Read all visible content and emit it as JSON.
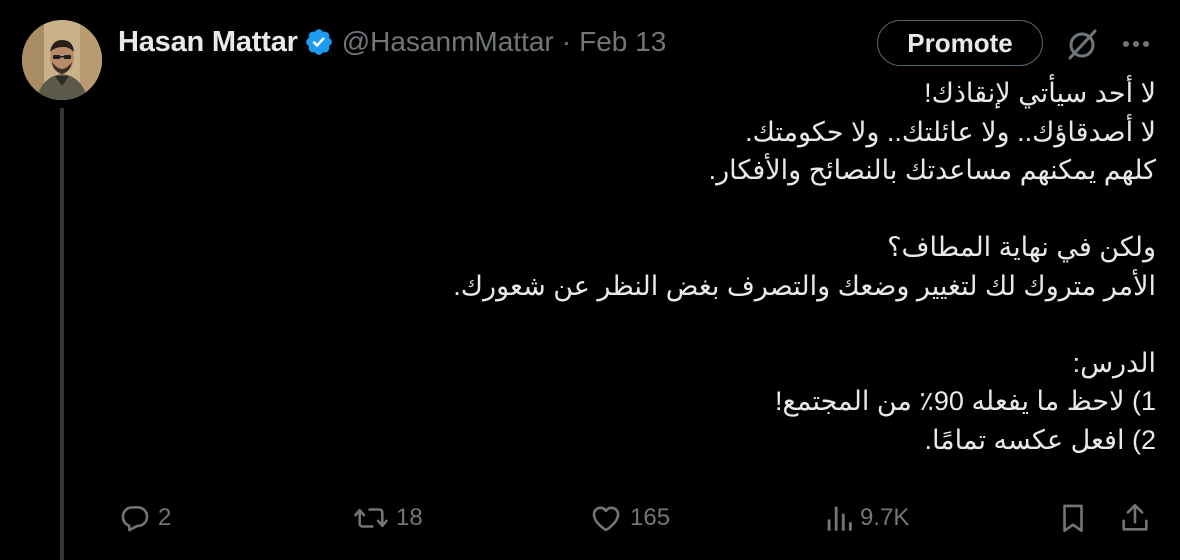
{
  "author": {
    "name": "Hasan Mattar",
    "handle": "@HasanmMattar",
    "separator": "·",
    "date": "Feb 13",
    "verified": true
  },
  "header_actions": {
    "promote_label": "Promote",
    "grok_icon": "slashed-circle-icon",
    "more_icon": "more-dots-icon"
  },
  "tweet_lines": [
    "لا أحد سيأتي لإنقاذك!",
    "لا أصدقاؤك.. ولا عائلتك.. ولا حكومتك.",
    "كلهم يمكنهم مساعدتك بالنصائح والأفكار.",
    "",
    "ولكن في نهاية المطاف؟",
    "الأمر متروك لك لتغيير وضعك والتصرف بغض النظر عن شعورك.",
    "",
    "الدرس:",
    "1) لاحظ ما يفعله 90٪ من المجتمع!",
    "2) افعل عكسه تمامًا."
  ],
  "metrics": {
    "replies": "2",
    "reposts": "18",
    "likes": "165",
    "views": "9.7K"
  },
  "colors": {
    "background": "#000000",
    "primary_text": "#e7e9ea",
    "secondary_text": "#71767b",
    "verified_badge": "#1d9bf0",
    "border": "#536471"
  }
}
